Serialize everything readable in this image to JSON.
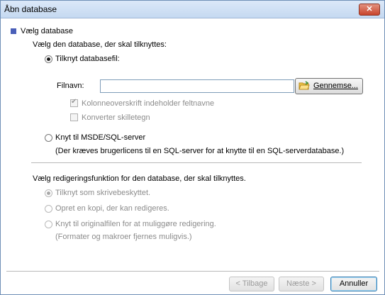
{
  "window": {
    "title": "Åbn database",
    "close_glyph": "✕"
  },
  "section1": {
    "heading": "Vælg database",
    "prompt": "Vælg den database, der skal tilknyttes:",
    "option_file": {
      "label": "Tilknyt databasefil:",
      "selected": true
    },
    "filename_label": "Filnavn:",
    "filename_value": "",
    "browse_label": "Gennemse...",
    "check_header": {
      "label": "Kolonneoverskrift indeholder feltnavne",
      "checked": true,
      "enabled": false
    },
    "check_convert": {
      "label": "Konverter skilletegn",
      "checked": false,
      "enabled": false
    },
    "option_server": {
      "label": "Knyt til MSDE/SQL-server",
      "selected": false
    },
    "server_note": "(Der kræves brugerlicens til en SQL-server for at knytte til en SQL-serverdatabase.)"
  },
  "section2": {
    "prompt": "Vælg redigeringsfunktion for den database, der skal tilknyttes.",
    "options": [
      {
        "label": "Tilknyt som skrivebeskyttet.",
        "selected": true,
        "enabled": false
      },
      {
        "label": "Opret en kopi, der kan redigeres.",
        "selected": false,
        "enabled": false
      },
      {
        "label": "Knyt til originalfilen for at muliggøre redigering.",
        "selected": false,
        "enabled": false
      }
    ],
    "note": "(Formater og makroer fjernes muligvis.)"
  },
  "footer": {
    "back_label": "< Tilbage",
    "next_label": "Næste >",
    "cancel_label": "Annuller"
  },
  "colors": {
    "section_marker": "#4a5fb8",
    "titlebar": "#c5d9f1",
    "close": "#c8452c"
  }
}
